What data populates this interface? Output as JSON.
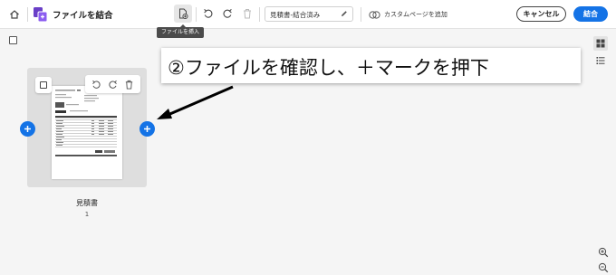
{
  "toolbar": {
    "title": "ファイルを結合",
    "filename": "見積書-結合済み",
    "custom_page_label": "カスタムページを追加",
    "cancel_label": "キャンセル",
    "combine_label": "結合",
    "accent_color": "#1473e6"
  },
  "tooltip": {
    "text": "ファイルを挿入"
  },
  "icons": {
    "home": "home-icon",
    "app": "combine-files-icon",
    "insert": "insert-file-icon",
    "undo": "undo-icon",
    "redo": "redo-icon",
    "delete": "trash-icon",
    "edit": "pencil-icon",
    "custom_page": "add-custom-page-icon",
    "grid_view": "grid-view-icon",
    "list_view": "list-view-icon",
    "zoom_in": "zoom-in-icon",
    "zoom_out": "zoom-out-icon",
    "add": "plus-icon"
  },
  "page": {
    "label": "見積書",
    "number": "1"
  },
  "callout": {
    "text": "②ファイルを確認し、＋マークを押下"
  }
}
